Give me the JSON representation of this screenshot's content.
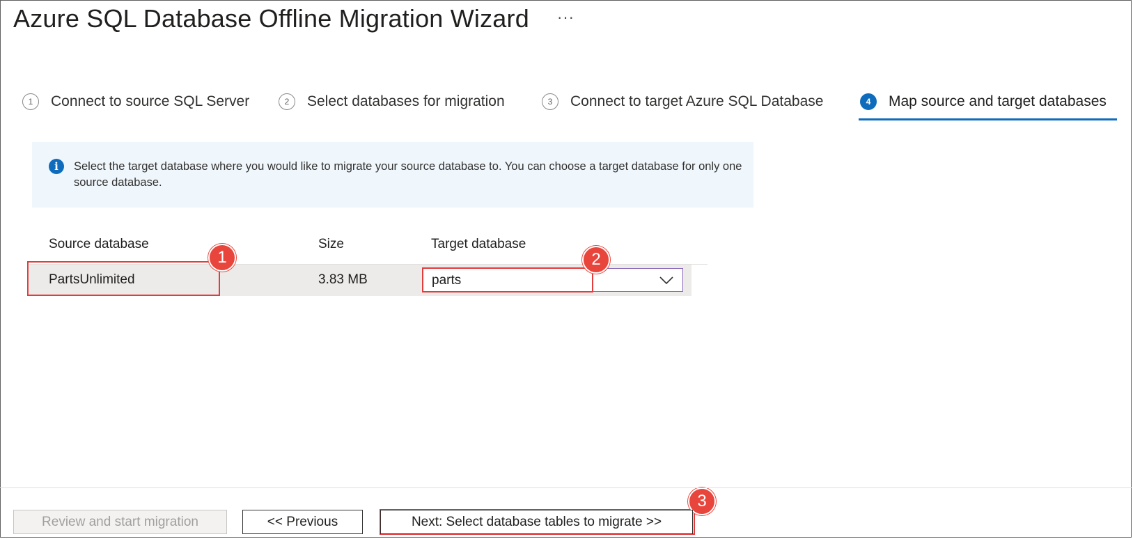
{
  "title": "Azure SQL Database Offline Migration Wizard",
  "more_label": "···",
  "steps": [
    {
      "num": "1",
      "label": "Connect to source SQL Server"
    },
    {
      "num": "2",
      "label": "Select databases for migration"
    },
    {
      "num": "3",
      "label": "Connect to target Azure SQL Database"
    },
    {
      "num": "4",
      "label": "Map source and target databases"
    }
  ],
  "active_step": 4,
  "info": {
    "icon": "info-icon",
    "text": "Select the target database where you would like to migrate your source database to. You can choose a target database for only one source database."
  },
  "table": {
    "headers": {
      "source": "Source database",
      "size": "Size",
      "target": "Target database"
    },
    "rows": [
      {
        "source": "PartsUnlimited",
        "size": "3.83 MB",
        "target": "parts"
      }
    ]
  },
  "callouts": [
    "1",
    "2",
    "3"
  ],
  "footer": {
    "review_label": "Review and start migration",
    "previous_label": "<< Previous",
    "next_label": "Next: Select database tables to migrate >>"
  },
  "colors": {
    "accent": "#0f6cbd",
    "callout": "#e8453c",
    "dropdown_border": "#8764b8"
  }
}
